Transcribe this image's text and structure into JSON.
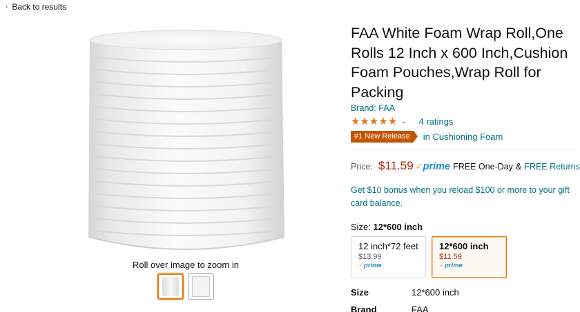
{
  "nav": {
    "back_label": "Back to results"
  },
  "gallery": {
    "zoom_hint": "Roll over image to zoom in"
  },
  "product": {
    "title": "FAA White Foam Wrap Roll,One Rolls 12 Inch x 600 Inch,Cushion Foam Pouches,Wrap Roll for Packing",
    "brand": "Brand: FAA",
    "stars": "★★★★★",
    "star_rating": 5,
    "ratings_count": "4 ratings",
    "badge": "#1 New Release",
    "badge_category": "in Cushioning Foam"
  },
  "pricing": {
    "label": "Price:",
    "price": "$11.59",
    "prime_check": "✓",
    "prime": "prime",
    "delivery": "FREE One-Day",
    "amp": "&",
    "returns": "FREE Returns"
  },
  "promo": {
    "bonus": "Get $10 bonus when you reload $100 or more to your gift card balance."
  },
  "size": {
    "label": "Size:",
    "selected": "12*600 inch",
    "options": [
      {
        "name": "12 inch*72 feet",
        "price": "$13.99",
        "prime": "prime"
      },
      {
        "name": "12*600 inch",
        "price": "$11.59",
        "prime": "prime"
      }
    ]
  },
  "specs": [
    {
      "key": "Size",
      "value": "12*600 inch"
    },
    {
      "key": "Brand",
      "value": "FAA"
    }
  ],
  "colors": {
    "link": "#007185",
    "price": "#b12704",
    "star": "#de7921",
    "badge": "#c45500",
    "prime": "#1f8ec4",
    "selected_border": "#e77600"
  }
}
